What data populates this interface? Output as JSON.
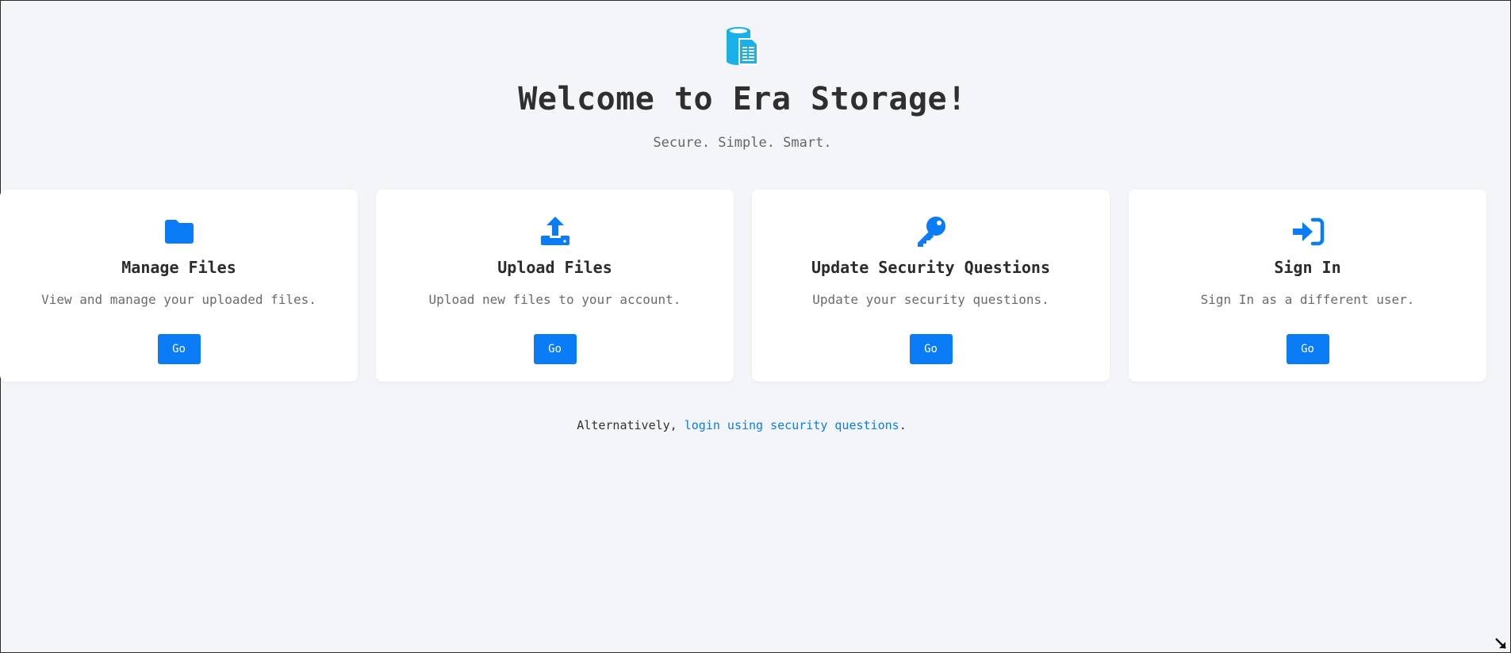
{
  "header": {
    "logo_icon": "storage-document-icon",
    "title": "Welcome to Era Storage!",
    "subtitle": "Secure. Simple. Smart."
  },
  "cards": [
    {
      "icon": "folder-icon",
      "title": "Manage Files",
      "description": "View and manage your uploaded files.",
      "button": "Go"
    },
    {
      "icon": "upload-icon",
      "title": "Upload Files",
      "description": "Upload new files to your account.",
      "button": "Go"
    },
    {
      "icon": "key-icon",
      "title": "Update Security Questions",
      "description": "Update your security questions.",
      "button": "Go"
    },
    {
      "icon": "sign-in-icon",
      "title": "Sign In",
      "description": "Sign In as a different user.",
      "button": "Go"
    }
  ],
  "footer": {
    "prefix": "Alternatively, ",
    "link": "login using security questions",
    "suffix": "."
  },
  "colors": {
    "accent": "#0a7cf5",
    "logo": "#1ab0e8",
    "background": "#f4f5f8"
  }
}
